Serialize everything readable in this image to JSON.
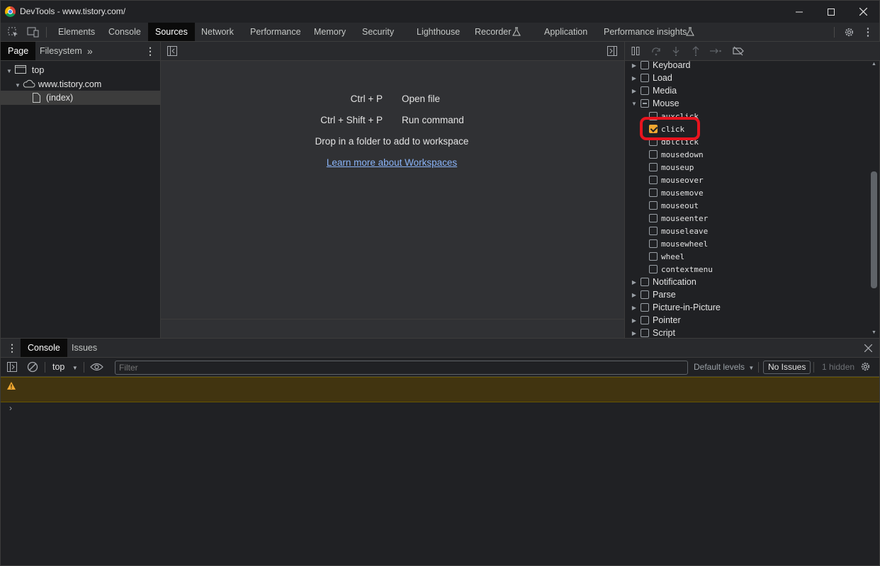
{
  "window": {
    "title": "DevTools - www.tistory.com/"
  },
  "main_tabs": [
    "Elements",
    "Console",
    "Sources",
    "Network",
    "Performance",
    "Memory",
    "Security",
    "Lighthouse",
    "Recorder",
    "Application",
    "Performance insights"
  ],
  "active_tab": "Sources",
  "navigator": {
    "tabs": [
      "Page",
      "Filesystem"
    ],
    "tree": {
      "top": "top",
      "domain": "www.tistory.com",
      "file": "(index)"
    }
  },
  "editor": {
    "shortcuts": [
      {
        "keys": "Ctrl + P",
        "label": "Open file"
      },
      {
        "keys": "Ctrl + Shift + P",
        "label": "Run command"
      }
    ],
    "drop_hint": "Drop in a folder to add to workspace",
    "learn_link": "Learn more about Workspaces"
  },
  "breakpoints": {
    "before": [
      "Keyboard",
      "Load",
      "Media"
    ],
    "expanded": "Mouse",
    "events": [
      {
        "name": "auxclick",
        "checked": false
      },
      {
        "name": "click",
        "checked": true
      },
      {
        "name": "dblclick",
        "checked": false
      },
      {
        "name": "mousedown",
        "checked": false
      },
      {
        "name": "mouseup",
        "checked": false
      },
      {
        "name": "mouseover",
        "checked": false
      },
      {
        "name": "mousemove",
        "checked": false
      },
      {
        "name": "mouseout",
        "checked": false
      },
      {
        "name": "mouseenter",
        "checked": false
      },
      {
        "name": "mouseleave",
        "checked": false
      },
      {
        "name": "mousewheel",
        "checked": false
      },
      {
        "name": "wheel",
        "checked": false
      },
      {
        "name": "contextmenu",
        "checked": false
      }
    ],
    "after": [
      "Notification",
      "Parse",
      "Picture-in-Picture",
      "Pointer",
      "Script"
    ],
    "highlight_color": "#e8141e",
    "checked_color": "#f0a830"
  },
  "drawer": {
    "tabs": [
      "Console",
      "Issues"
    ],
    "context": "top",
    "filter_placeholder": "Filter",
    "levels": "Default levels",
    "issues_button": "No Issues",
    "hidden": "1 hidden"
  }
}
